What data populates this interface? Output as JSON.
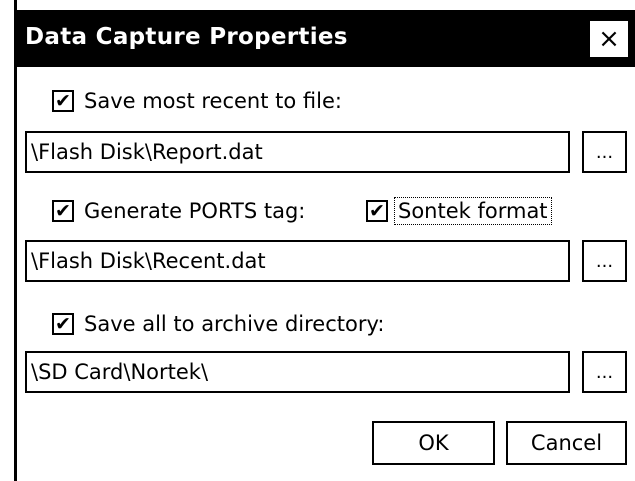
{
  "dialog": {
    "title": "Data Capture Properties",
    "close_label": "×"
  },
  "save_recent": {
    "checked": true,
    "label": "Save most recent to file:",
    "path": "\\Flash Disk\\Report.dat",
    "browse_label": "..."
  },
  "ports": {
    "generate_checked": true,
    "generate_label": "Generate PORTS tag:",
    "sontek_checked": true,
    "sontek_label": "Sontek format",
    "path": "\\Flash Disk\\Recent.dat",
    "browse_label": "..."
  },
  "archive": {
    "checked": true,
    "label": "Save all to archive directory:",
    "path": "\\SD Card\\Nortek\\",
    "browse_label": "..."
  },
  "buttons": {
    "ok_label": "OK",
    "cancel_label": "Cancel"
  },
  "check_glyph": "✔"
}
